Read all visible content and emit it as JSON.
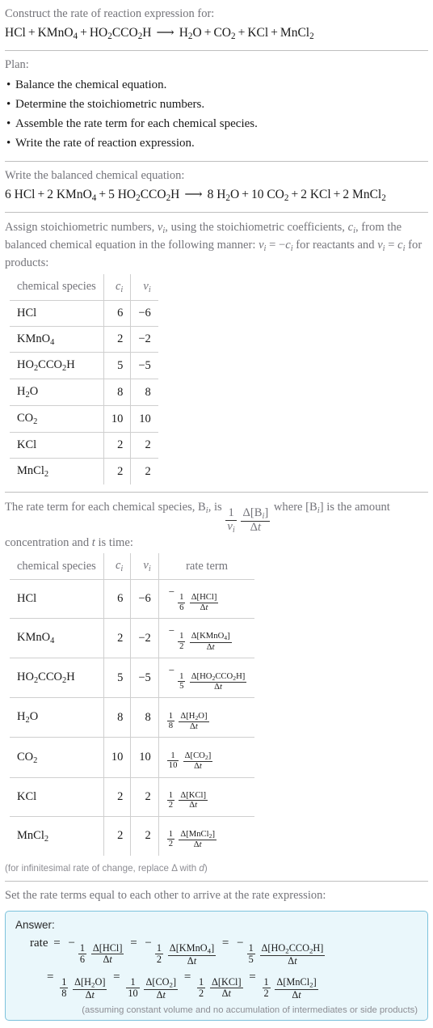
{
  "header": {
    "prompt": "Construct the rate of reaction expression for:",
    "equation": {
      "reactants": [
        {
          "formula": "HCl"
        },
        {
          "formula": "KMnO4"
        },
        {
          "formula": "HO2CCO2H"
        }
      ],
      "products": [
        {
          "formula": "H2O"
        },
        {
          "formula": "CO2"
        },
        {
          "formula": "KCl"
        },
        {
          "formula": "MnCl2"
        }
      ],
      "arrow": "⟶"
    }
  },
  "plan": {
    "title": "Plan:",
    "steps": [
      "Balance the chemical equation.",
      "Determine the stoichiometric numbers.",
      "Assemble the rate term for each chemical species.",
      "Write the rate of reaction expression."
    ]
  },
  "balanced": {
    "prompt": "Write the balanced chemical equation:",
    "reactants": [
      {
        "coef": "6",
        "formula": "HCl"
      },
      {
        "coef": "2",
        "formula": "KMnO4"
      },
      {
        "coef": "5",
        "formula": "HO2CCO2H"
      }
    ],
    "products": [
      {
        "coef": "8",
        "formula": "H2O"
      },
      {
        "coef": "10",
        "formula": "CO2"
      },
      {
        "coef": "2",
        "formula": "KCl"
      },
      {
        "coef": "2",
        "formula": "MnCl2"
      }
    ]
  },
  "stoich": {
    "paragraph_parts": {
      "p1": "Assign stoichiometric numbers, ",
      "p2": ", using the stoichiometric coefficients, ",
      "p3": ", from the balanced chemical equation in the following manner: ",
      "p4": " for reactants and ",
      "p5": " for products:"
    },
    "symbols": {
      "nu": "ν",
      "c": "c",
      "i": "i",
      "nu_eq_minus_c": "νᵢ = −cᵢ",
      "nu_eq_c": "νᵢ = cᵢ"
    },
    "table": {
      "headers": [
        "chemical species",
        "cᵢ",
        "νᵢ"
      ],
      "rows": [
        {
          "species": "HCl",
          "c": "6",
          "nu": "−6"
        },
        {
          "species": "KMnO4",
          "c": "2",
          "nu": "−2"
        },
        {
          "species": "HO2CCO2H",
          "c": "5",
          "nu": "−5"
        },
        {
          "species": "H2O",
          "c": "8",
          "nu": "8"
        },
        {
          "species": "CO2",
          "c": "10",
          "nu": "10"
        },
        {
          "species": "KCl",
          "c": "2",
          "nu": "2"
        },
        {
          "species": "MnCl2",
          "c": "2",
          "nu": "2"
        }
      ]
    }
  },
  "rateterm": {
    "paragraph_parts": {
      "p1": "The rate term for each chemical species, ",
      "p2": ", is ",
      "p3": " where ",
      "p4": " is the amount concentration and ",
      "p5": " is time:"
    },
    "symbols": {
      "B_i": "Bᵢ",
      "bracket_B_i": "[Bᵢ]",
      "one": "1",
      "nu_i": "νᵢ",
      "delta_B_i": "Δ[Bᵢ]",
      "delta_t": "Δt",
      "t": "t"
    },
    "table": {
      "headers": [
        "chemical species",
        "cᵢ",
        "νᵢ",
        "rate term"
      ],
      "rows": [
        {
          "species": "HCl",
          "c": "6",
          "nu": "−6",
          "sign": "−",
          "num": "1",
          "den": "6",
          "delta": "Δ[HCl]",
          "dt": "Δt"
        },
        {
          "species": "KMnO4",
          "c": "2",
          "nu": "−2",
          "sign": "−",
          "num": "1",
          "den": "2",
          "delta": "Δ[KMnO4]",
          "dt": "Δt"
        },
        {
          "species": "HO2CCO2H",
          "c": "5",
          "nu": "−5",
          "sign": "−",
          "num": "1",
          "den": "5",
          "delta": "Δ[HO2CCO2H]",
          "dt": "Δt"
        },
        {
          "species": "H2O",
          "c": "8",
          "nu": "8",
          "sign": "",
          "num": "1",
          "den": "8",
          "delta": "Δ[H2O]",
          "dt": "Δt"
        },
        {
          "species": "CO2",
          "c": "10",
          "nu": "10",
          "sign": "",
          "num": "1",
          "den": "10",
          "delta": "Δ[CO2]",
          "dt": "Δt"
        },
        {
          "species": "KCl",
          "c": "2",
          "nu": "2",
          "sign": "",
          "num": "1",
          "den": "2",
          "delta": "Δ[KCl]",
          "dt": "Δt"
        },
        {
          "species": "MnCl2",
          "c": "2",
          "nu": "2",
          "sign": "",
          "num": "1",
          "den": "2",
          "delta": "Δ[MnCl2]",
          "dt": "Δt"
        }
      ]
    },
    "footnote": "(for infinitesimal rate of change, replace Δ with d)"
  },
  "answer": {
    "prompt": "Set the rate terms equal to each other to arrive at the rate expression:",
    "label": "Answer:",
    "rate_label": "rate",
    "equals": "=",
    "line1": [
      {
        "sign": "−",
        "num": "1",
        "den": "6",
        "delta": "Δ[HCl]",
        "dt": "Δt"
      },
      {
        "sign": "−",
        "num": "1",
        "den": "2",
        "delta": "Δ[KMnO4]",
        "dt": "Δt"
      },
      {
        "sign": "−",
        "num": "1",
        "den": "5",
        "delta": "Δ[HO2CCO2H]",
        "dt": "Δt"
      }
    ],
    "line2": [
      {
        "sign": "",
        "num": "1",
        "den": "8",
        "delta": "Δ[H2O]",
        "dt": "Δt"
      },
      {
        "sign": "",
        "num": "1",
        "den": "10",
        "delta": "Δ[CO2]",
        "dt": "Δt"
      },
      {
        "sign": "",
        "num": "1",
        "den": "2",
        "delta": "Δ[KCl]",
        "dt": "Δt"
      },
      {
        "sign": "",
        "num": "1",
        "den": "2",
        "delta": "Δ[MnCl2]",
        "dt": "Δt"
      }
    ],
    "note": "(assuming constant volume and no accumulation of intermediates or side products)"
  },
  "colors": {
    "prompt_text": "#74747a",
    "body_text": "#1a1a1a",
    "rule": "#bfbfbf",
    "table_border": "#cfcfcf",
    "answer_border": "#7cc2dc",
    "answer_bg": "#eaf7fb",
    "note_text": "#8d8d93"
  }
}
